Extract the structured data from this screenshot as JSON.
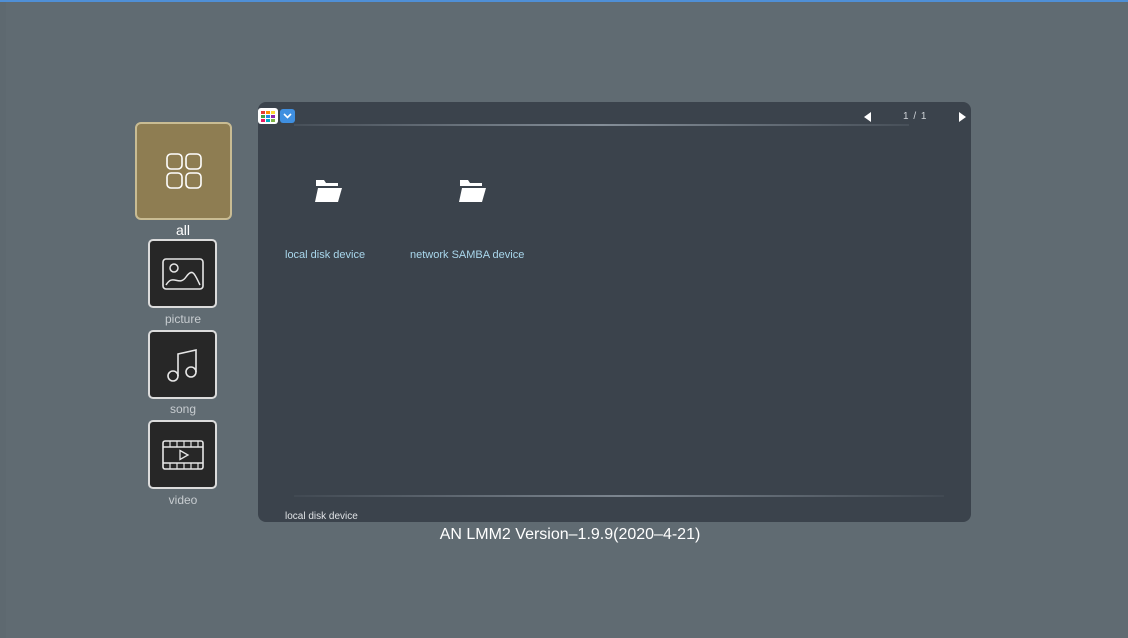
{
  "sidebar": {
    "items": [
      {
        "label": "all",
        "icon": "four-squares-icon",
        "selected": true
      },
      {
        "label": "picture",
        "icon": "picture-icon",
        "selected": false
      },
      {
        "label": "song",
        "icon": "music-note-icon",
        "selected": false
      },
      {
        "label": "video",
        "icon": "film-icon",
        "selected": false
      }
    ]
  },
  "browser": {
    "view_toggle_icon": "grid-view-icon",
    "pager": {
      "text": "1 / 1",
      "prev_icon": "triangle-left-icon",
      "next_icon": "triangle-right-icon"
    },
    "folders": [
      {
        "label": "local disk device",
        "icon": "folder-icon"
      },
      {
        "label": "network SAMBA device",
        "icon": "folder-icon"
      }
    ],
    "status": "local disk device"
  },
  "footer": {
    "version": "AN LMM2 Version–1.9.9(2020–4-21)"
  },
  "colors": {
    "background": "#606b72",
    "panel": "#3b434c",
    "selected_tile": "#8e7d52",
    "folder_label": "#a9d7ec",
    "accent": "#3f8fe0"
  }
}
